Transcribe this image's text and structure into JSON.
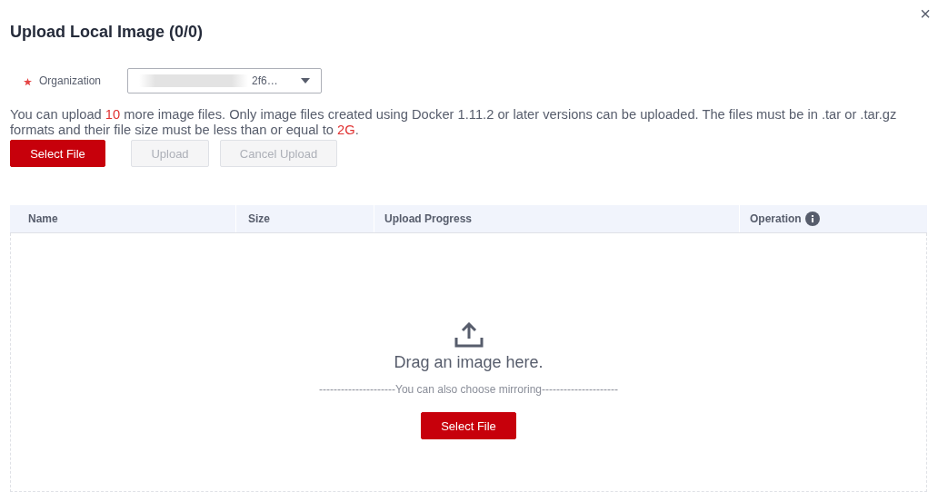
{
  "dialog": {
    "title": "Upload Local Image (0/0)",
    "close": "×"
  },
  "organization": {
    "label": "Organization",
    "required": true,
    "value": "2f6…"
  },
  "notice": "You can upload *10* more image files. Only image files created using Docker 1.11.2 or later versions can be uploaded. The files must be in .tar or .tar.gz formats and their file size must be less than or equal to *2G*.",
  "buttons": [
    {
      "label": "Select File",
      "kind": "primary",
      "disabled": false
    },
    {
      "label": "Upload",
      "kind": "secondary",
      "disabled": true
    },
    {
      "label": "Cancel Upload",
      "kind": "secondary",
      "disabled": true
    }
  ],
  "table": {
    "columns": [
      {
        "label": "Name",
        "info": false
      },
      {
        "label": "Size",
        "info": false
      },
      {
        "label": "Upload Progress",
        "info": false
      },
      {
        "label": "Operation",
        "info": true
      }
    ]
  },
  "dropzone": {
    "message": "Drag an image here.",
    "divider": "---------------------You can also choose mirroring---------------------",
    "button": "Select File"
  }
}
